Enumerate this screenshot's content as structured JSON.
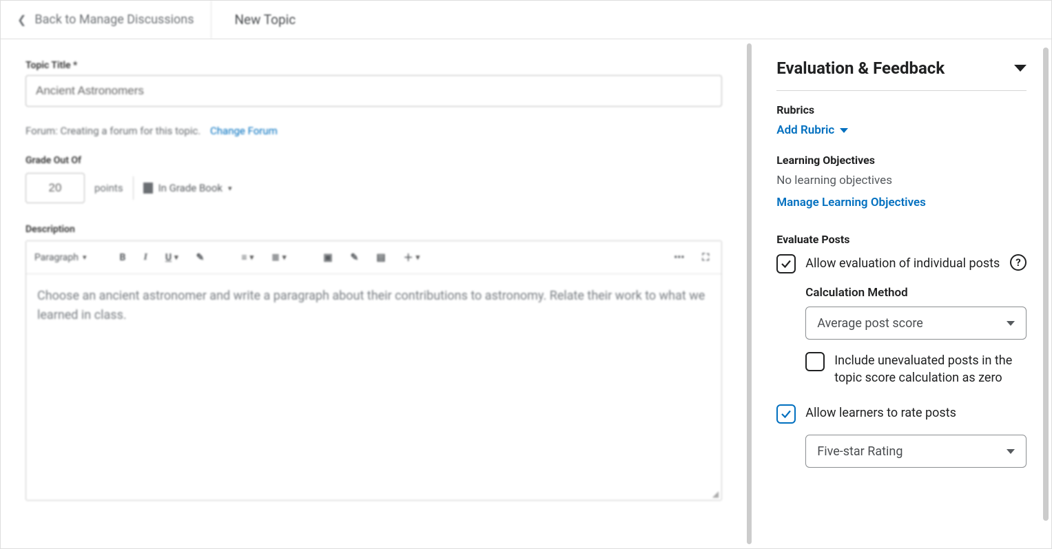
{
  "header": {
    "back_label": "Back to Manage Discussions",
    "page_title": "New Topic"
  },
  "topic": {
    "title_label": "Topic Title *",
    "title_value": "Ancient Astronomers",
    "forum_prefix": "Forum: Creating a forum for this topic.",
    "change_forum": "Change Forum"
  },
  "grade": {
    "label": "Grade Out Of",
    "value": "20",
    "points": "points",
    "in_gradebook": "In Grade Book"
  },
  "description": {
    "label": "Description",
    "paragraph_selector": "Paragraph",
    "body": "Choose an ancient astronomer and write a paragraph about their contributions to astronomy. Relate their work to what we learned in class."
  },
  "panel": {
    "title": "Evaluation & Feedback",
    "rubrics_label": "Rubrics",
    "add_rubric": "Add Rubric",
    "objectives_label": "Learning Objectives",
    "no_objectives": "No learning objectives",
    "manage_objectives": "Manage Learning Objectives",
    "evaluate_label": "Evaluate Posts",
    "allow_eval": "Allow evaluation of individual posts",
    "calc_method_label": "Calculation Method",
    "calc_method_value": "Average post score",
    "include_uneval": "Include unevaluated posts in the topic score calculation as zero",
    "allow_rate": "Allow learners to rate posts",
    "rating_value": "Five-star Rating"
  }
}
